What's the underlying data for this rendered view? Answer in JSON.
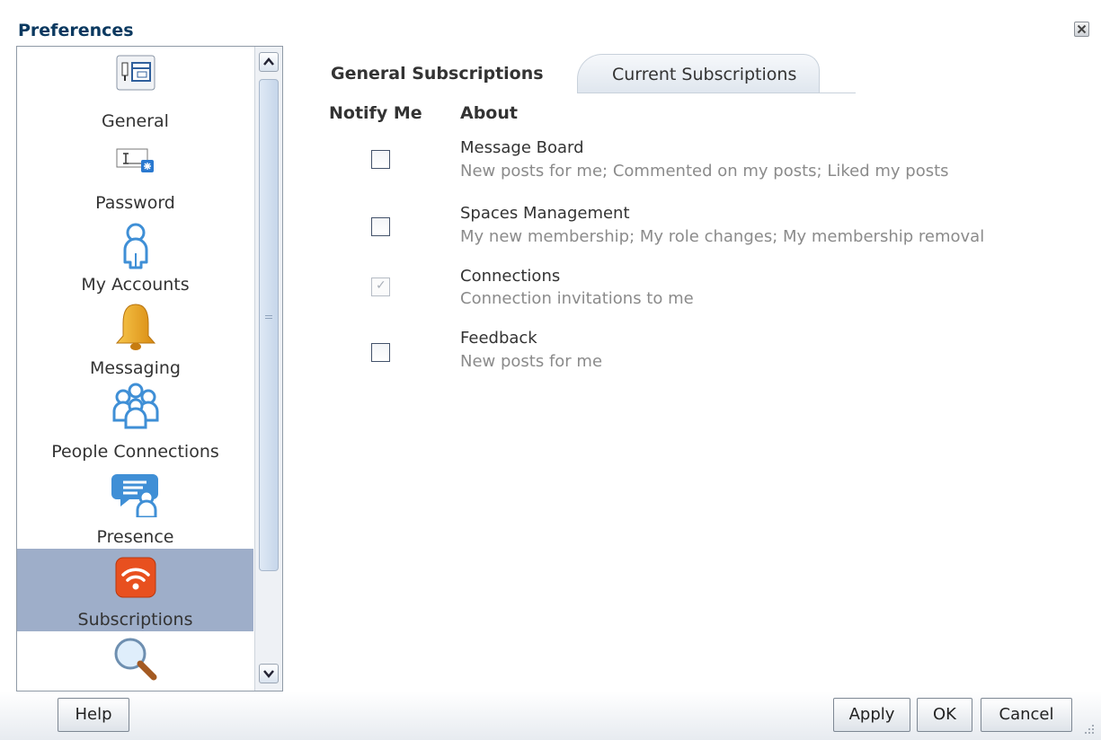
{
  "dialog": {
    "title": "Preferences"
  },
  "nav": {
    "items": [
      {
        "label": "General",
        "icon": "general-settings-icon"
      },
      {
        "label": "Password",
        "icon": "password-field-icon"
      },
      {
        "label": "My Accounts",
        "icon": "person-icon"
      },
      {
        "label": "Messaging",
        "icon": "bell-icon"
      },
      {
        "label": "People Connections",
        "icon": "people-group-icon"
      },
      {
        "label": "Presence",
        "icon": "chat-bubble-person-icon"
      },
      {
        "label": "Subscriptions",
        "icon": "rss-feed-icon",
        "selected": true
      },
      {
        "label": "",
        "icon": "magnifier-icon"
      }
    ]
  },
  "tabs": [
    {
      "label": "General Subscriptions",
      "active": true
    },
    {
      "label": "Current Subscriptions",
      "active": false
    }
  ],
  "columns": {
    "notify": "Notify Me",
    "about": "About"
  },
  "subscriptions": [
    {
      "title": "Message Board",
      "desc": "New posts for me; Commented on my posts; Liked my posts",
      "checked": false,
      "disabled": false
    },
    {
      "title": "Spaces Management",
      "desc": "My new membership; My role changes; My membership removal",
      "checked": false,
      "disabled": false
    },
    {
      "title": "Connections",
      "desc": "Connection invitations to me",
      "checked": true,
      "disabled": true
    },
    {
      "title": "Feedback",
      "desc": "New posts for me",
      "checked": false,
      "disabled": false
    }
  ],
  "footer": {
    "help": "Help",
    "apply": "Apply",
    "ok": "OK",
    "cancel": "Cancel"
  },
  "colors": {
    "title": "#0b3960",
    "selected_nav": "#9eaec9",
    "rss": "#e8501f",
    "person": "#3f8fd6",
    "bell": "#e8a317"
  }
}
